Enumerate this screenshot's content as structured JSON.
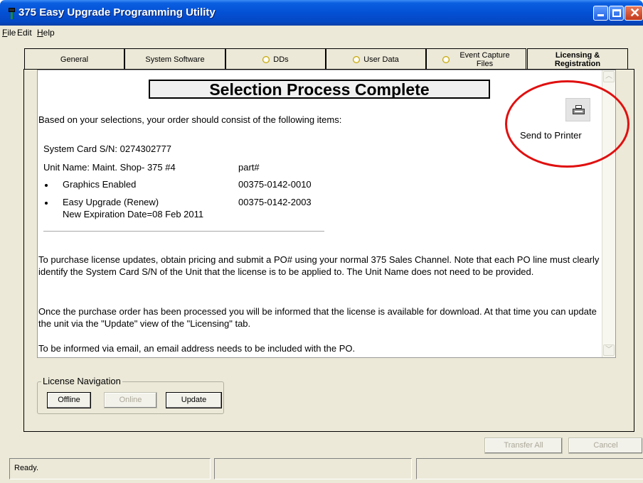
{
  "window": {
    "title": "375 Easy Upgrade Programming Utility"
  },
  "menu": {
    "file": {
      "label": "File",
      "hotkey": "F",
      "rest": "ile"
    },
    "edit": {
      "label": "Edit"
    },
    "help": {
      "label": "Help",
      "hotkey": "H",
      "rest": "elp"
    }
  },
  "tabs": [
    {
      "label": "General",
      "indicator": false
    },
    {
      "label": "System Software",
      "indicator": false
    },
    {
      "label": "DDs",
      "indicator": true
    },
    {
      "label": "User Data",
      "indicator": true
    },
    {
      "label_line1": "Event Capture",
      "label_line2": "Files",
      "indicator": true
    },
    {
      "label_line1": "Licensing &",
      "label_line2": "Registration",
      "active": true
    }
  ],
  "content": {
    "heading": "Selection Process Complete",
    "intro": "Based on your selections, your order should consist of the following items:",
    "system_card": "System Card S/N: 0274302777",
    "unit_name": "Unit Name: Maint. Shop- 375 #4",
    "part_header": "part#",
    "items": [
      {
        "name": "Graphics Enabled",
        "part": "00375-0142-0010"
      },
      {
        "name": "Easy Upgrade (Renew)",
        "subtext": "New Expiration Date=08 Feb 2011",
        "part": "00375-0142-2003"
      }
    ],
    "para1": "To purchase license updates, obtain pricing and submit a PO# using your normal 375 Sales Channel. Note that each PO line must clearly identify the System Card S/N of the Unit that the license is to be applied to. The Unit Name does not need to be provided.",
    "para2": "Once the purchase order has been processed you will be informed that the license is available for download. At that time you can update the unit via the \"Update\" view of the \"Licensing\" tab.",
    "para3": "To be informed via email, an email address needs to be included with the PO.",
    "send_to_printer": "Send to Printer",
    "printer_icon": "printer-icon",
    "highlight_color": "#e01010"
  },
  "license_nav": {
    "label": "License Navigation",
    "offline": "Offline",
    "online": "Online",
    "update": "Update"
  },
  "footer_buttons": {
    "transfer_all": "Transfer All",
    "cancel": "Cancel"
  },
  "status": {
    "text": "Ready."
  }
}
